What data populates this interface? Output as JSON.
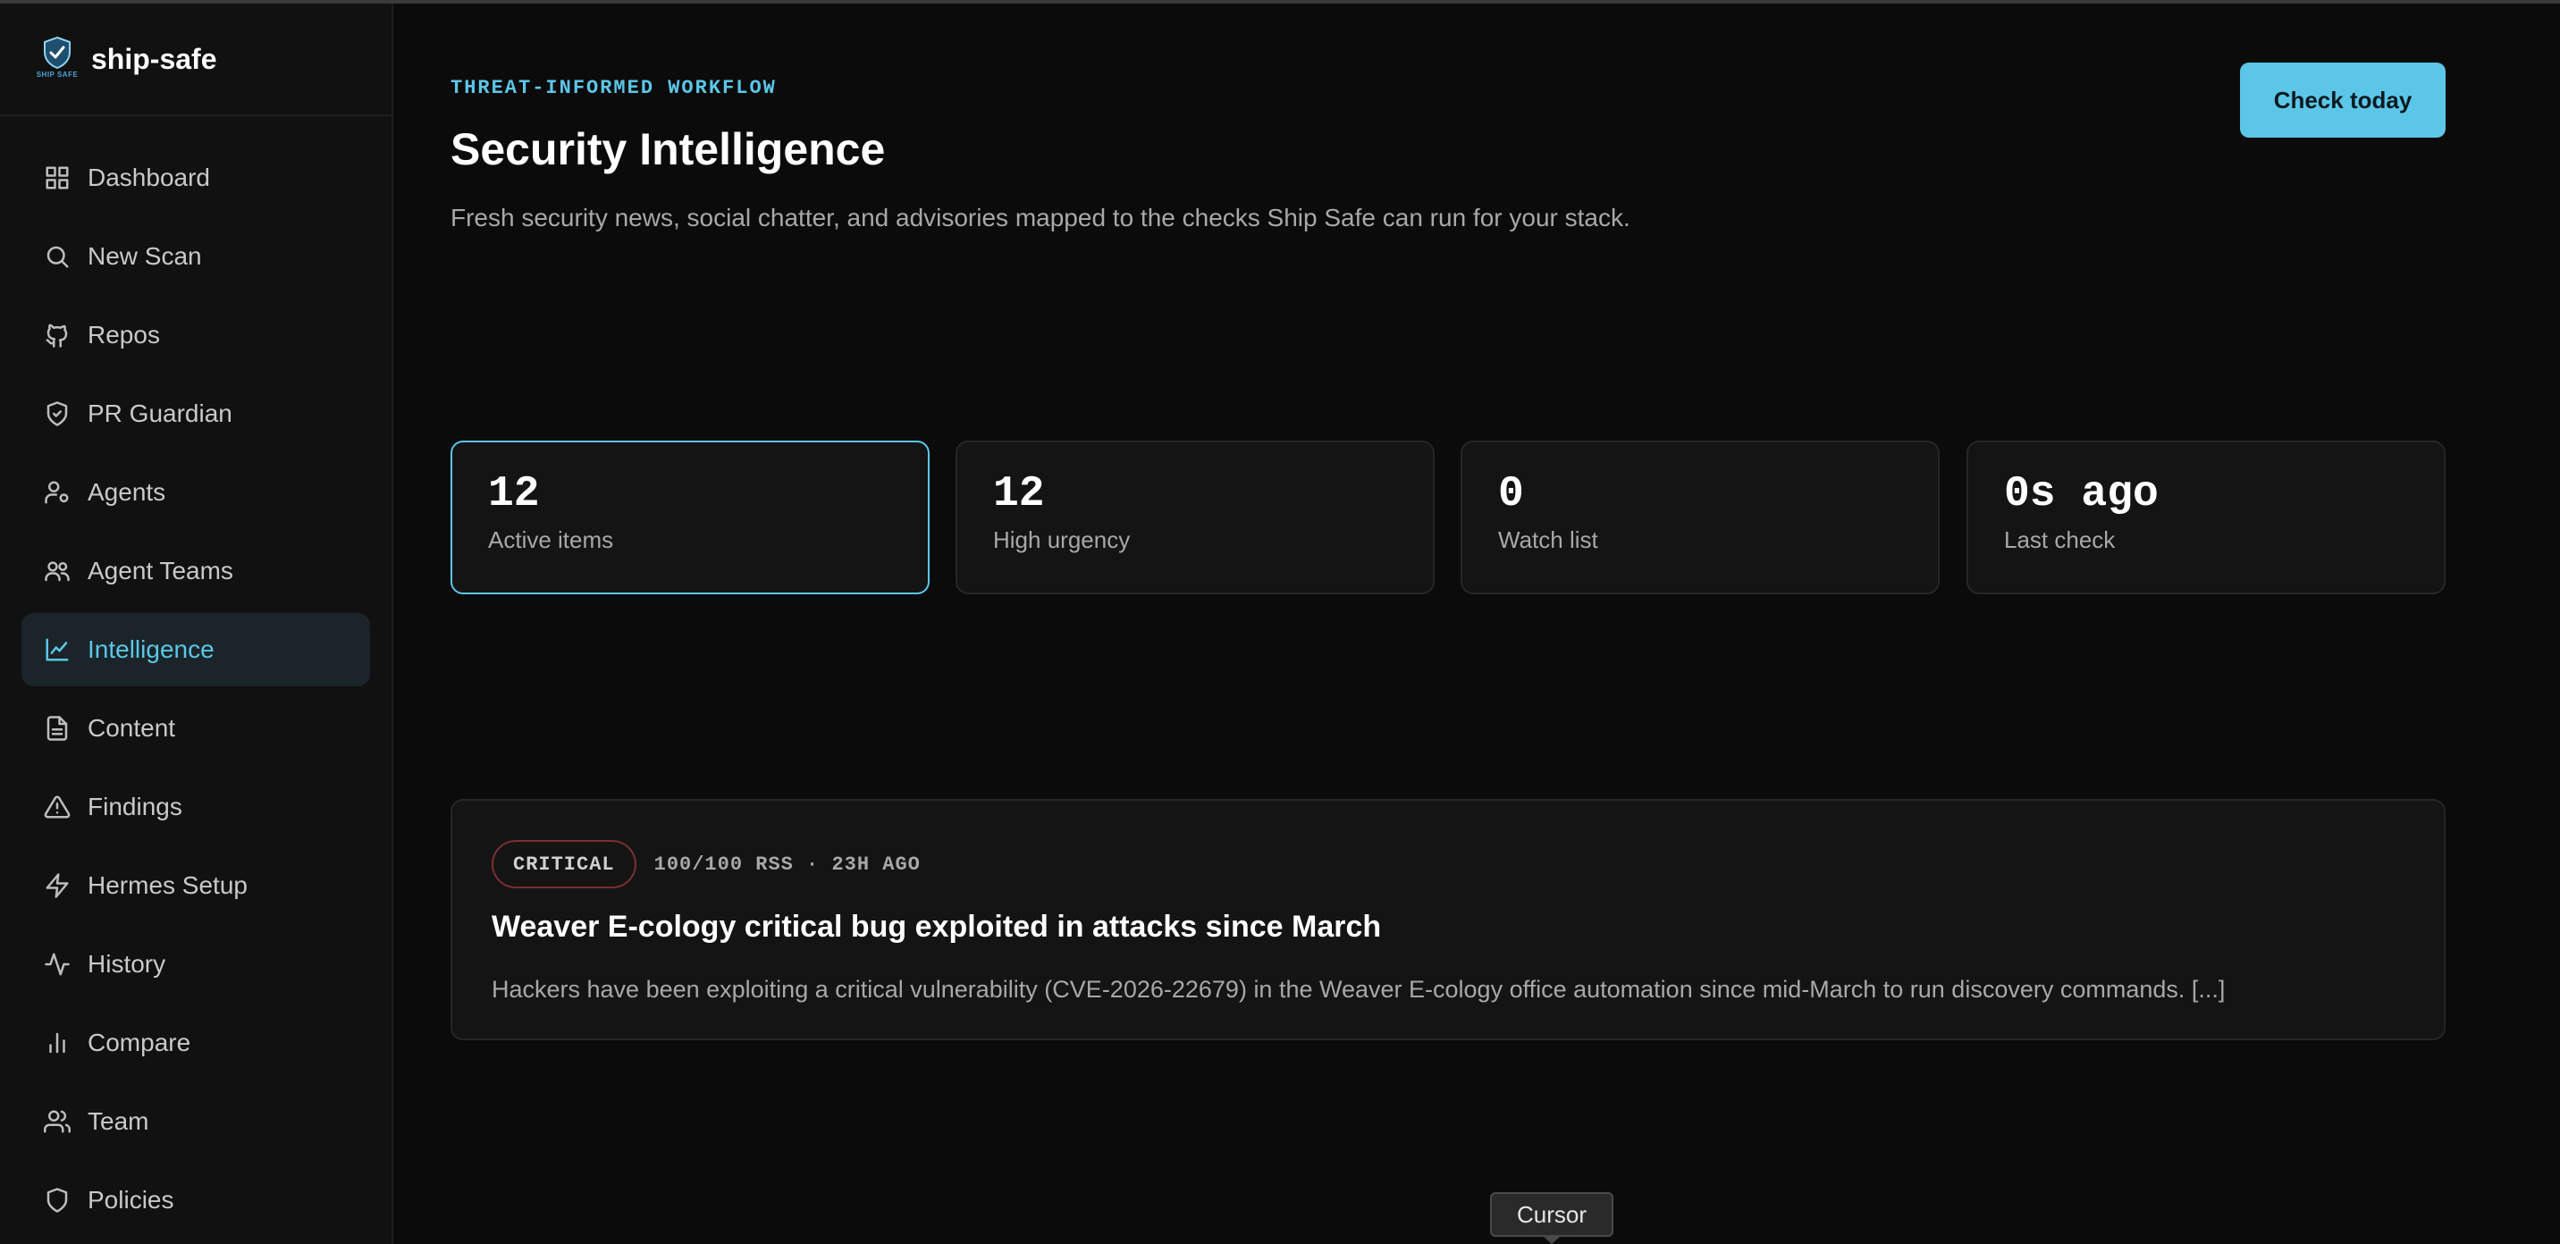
{
  "app": {
    "name": "ship-safe",
    "logo_text": "SHIP SAFE"
  },
  "sidebar": {
    "items": [
      {
        "label": "Dashboard",
        "icon": "grid-icon"
      },
      {
        "label": "New Scan",
        "icon": "search-icon"
      },
      {
        "label": "Repos",
        "icon": "github-icon"
      },
      {
        "label": "PR Guardian",
        "icon": "shield-check-icon"
      },
      {
        "label": "Agents",
        "icon": "user-gear-icon"
      },
      {
        "label": "Agent Teams",
        "icon": "users-icon"
      },
      {
        "label": "Intelligence",
        "icon": "chart-line-icon",
        "active": true
      },
      {
        "label": "Content",
        "icon": "file-text-icon"
      },
      {
        "label": "Findings",
        "icon": "warning-triangle-icon"
      },
      {
        "label": "Hermes Setup",
        "icon": "lightning-icon"
      },
      {
        "label": "History",
        "icon": "activity-icon"
      },
      {
        "label": "Compare",
        "icon": "bar-chart-icon"
      },
      {
        "label": "Team",
        "icon": "team-icon"
      },
      {
        "label": "Policies",
        "icon": "shield-icon"
      }
    ]
  },
  "header": {
    "eyebrow": "THREAT-INFORMED WORKFLOW",
    "title": "Security Intelligence",
    "subtitle": "Fresh security news, social chatter, and advisories mapped to the checks Ship Safe can run for your stack.",
    "action_label": "Check today"
  },
  "stats": [
    {
      "value": "12",
      "label": "Active items"
    },
    {
      "value": "12",
      "label": "High urgency"
    },
    {
      "value": "0",
      "label": "Watch list"
    },
    {
      "value": "0s ago",
      "label": "Last check"
    }
  ],
  "feed": [
    {
      "severity": "CRITICAL",
      "meta": "100/100 RSS · 23H AGO",
      "title": "Weaver E-cology critical bug exploited in attacks since March",
      "summary": "Hackers have been exploiting a critical vulnerability (CVE-2026-22679) in the Weaver E-cology office automation since mid-March to run discovery commands. [...]"
    }
  ],
  "tooltip": "Cursor",
  "colors": {
    "accent": "#5cc6e8",
    "background": "#0b0b0b",
    "sidebar": "#111111",
    "card": "#141414",
    "critical_border": "#7a2f2f"
  }
}
